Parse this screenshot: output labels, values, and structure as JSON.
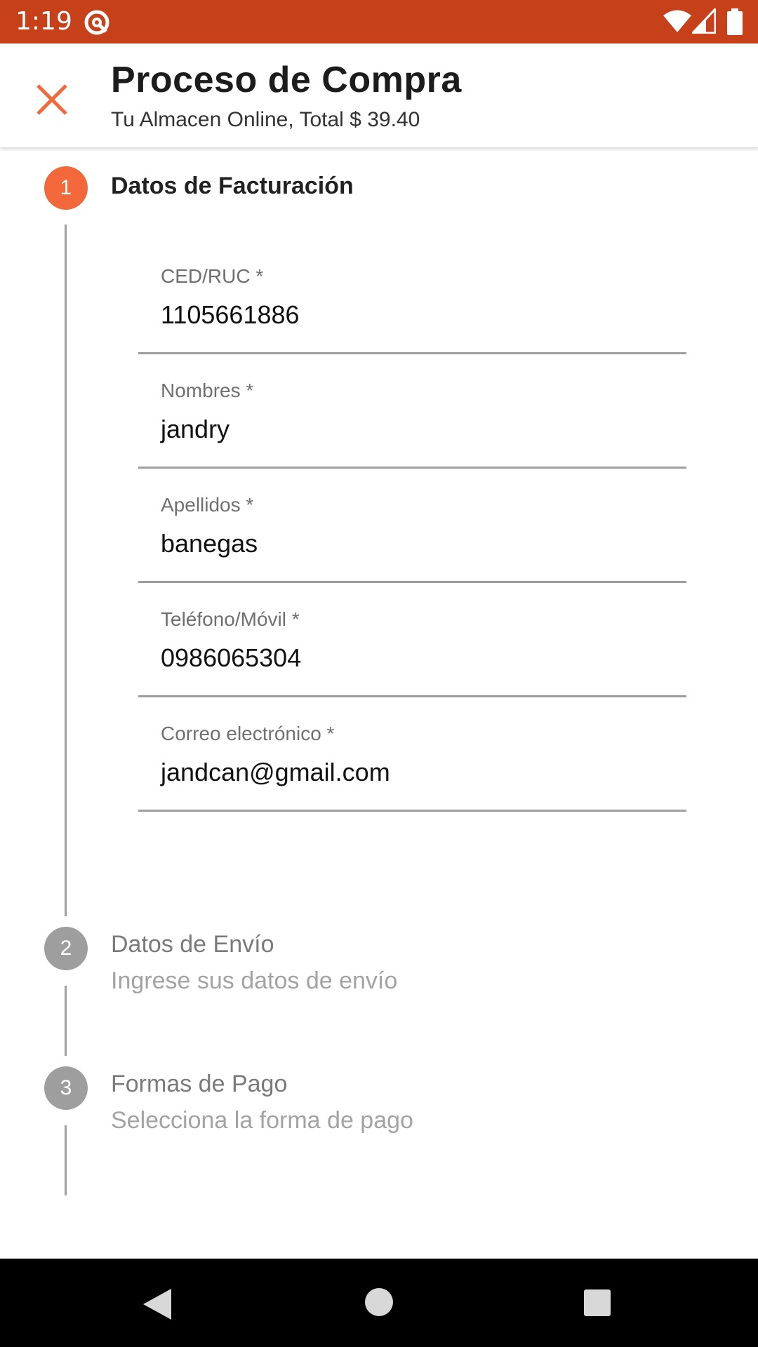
{
  "status_bar": {
    "time": "1:19",
    "icons": [
      "vpn-icon",
      "wifi-icon",
      "signal-icon",
      "battery-icon"
    ],
    "background": "#c6401a"
  },
  "app_bar": {
    "title": "Proceso de Compra",
    "subtitle": "Tu Almacen Online, Total $ 39.40",
    "close_icon": "close-icon",
    "accent": "#f2683b"
  },
  "steps": [
    {
      "number": "1",
      "title": "Datos de Facturación",
      "state": "active",
      "fields": [
        {
          "label": "CED/RUC *",
          "value": "1105661886"
        },
        {
          "label": "Nombres *",
          "value": "jandry"
        },
        {
          "label": "Apellidos *",
          "value": "banegas"
        },
        {
          "label": "Teléfono/Móvil *",
          "value": "0986065304"
        },
        {
          "label": "Correo electrónico *",
          "value": "jandcan@gmail.com"
        }
      ]
    },
    {
      "number": "2",
      "title": "Datos de Envío",
      "subtitle": "Ingrese sus datos de envío",
      "state": "inactive"
    },
    {
      "number": "3",
      "title": "Formas de Pago",
      "subtitle": "Selecciona la forma de pago",
      "state": "inactive"
    }
  ],
  "nav_bar": {
    "icons": [
      "back-icon",
      "home-icon",
      "recents-icon"
    ]
  }
}
